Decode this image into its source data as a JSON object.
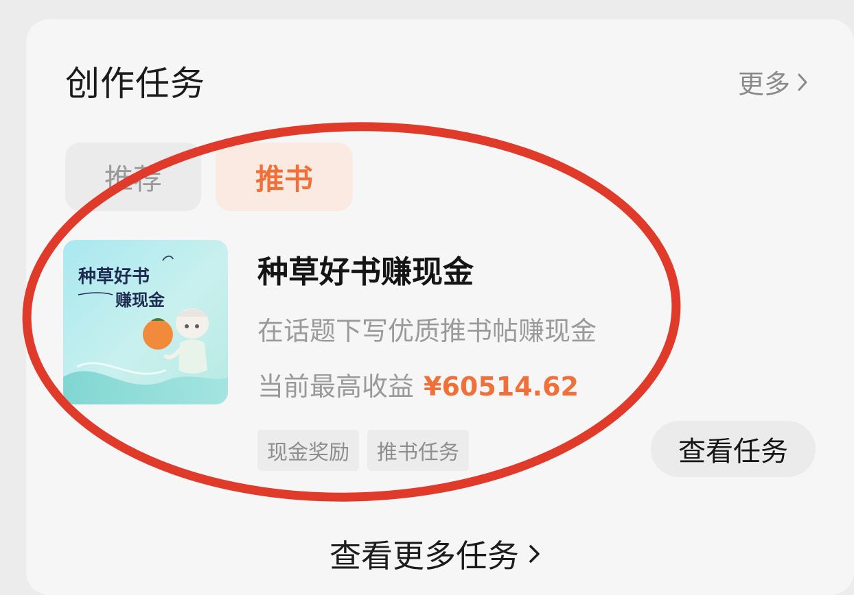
{
  "section": {
    "title": "创作任务",
    "more_label": "更多"
  },
  "tabs": [
    {
      "label": "推荐",
      "active": false
    },
    {
      "label": "推书",
      "active": true
    }
  ],
  "task": {
    "thumbnail_text_line1": "种草好书",
    "thumbnail_text_line2": "赚现金",
    "title": "种草好书赚现金",
    "description": "在话题下写优质推书帖赚现金",
    "earnings_label": "当前最高收益",
    "earnings_amount": "¥60514.62",
    "tags": [
      "现金奖励",
      "推书任务"
    ],
    "action_label": "查看任务"
  },
  "footer": {
    "view_more_label": "查看更多任务"
  },
  "colors": {
    "accent": "#f0703a",
    "annotation_circle": "#e03a2a",
    "card_bg": "#f6f6f6"
  }
}
